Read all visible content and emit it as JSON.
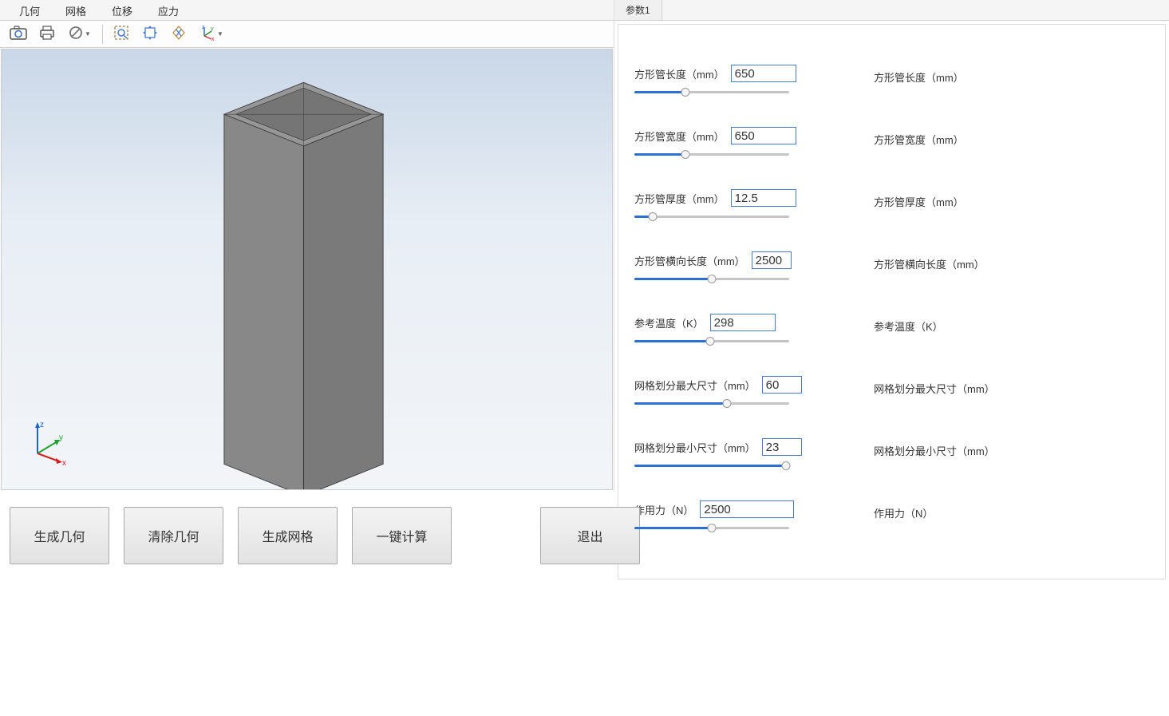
{
  "menubar": {
    "items": [
      "几何",
      "网格",
      "位移",
      "应力"
    ]
  },
  "toolbar": {
    "icons": [
      "camera-icon",
      "print-icon",
      "no-symbol-icon",
      "select-box-icon",
      "move-icon",
      "refresh-triangles-icon",
      "axis-xyz-icon"
    ]
  },
  "right_tab": {
    "label": "参数1"
  },
  "params": [
    {
      "label": "方形管长度（mm）",
      "value": "650",
      "right_label": "方形管长度（mm）",
      "slider_pct": 33
    },
    {
      "label": "方形管宽度（mm）",
      "value": "650",
      "right_label": "方形管宽度（mm）",
      "slider_pct": 33
    },
    {
      "label": "方形管厚度（mm）",
      "value": "12.5",
      "right_label": "方形管厚度（mm）",
      "slider_pct": 12
    },
    {
      "label": "方形管横向长度（mm）",
      "value": "2500",
      "right_label": "方形管横向长度（mm）",
      "slider_pct": 50,
      "input_class": "narrow"
    },
    {
      "label": "参考温度（K）",
      "value": "298",
      "right_label": "参考温度（K）",
      "slider_pct": 49,
      "input_class": ""
    },
    {
      "label": "网格划分最大尺寸（mm）",
      "value": "60",
      "right_label": "网格划分最大尺寸（mm）",
      "slider_pct": 60,
      "input_class": "narrow"
    },
    {
      "label": "网格划分最小尺寸（mm）",
      "value": "23",
      "right_label": "网格划分最小尺寸（mm）",
      "slider_pct": 98,
      "input_class": "narrow"
    },
    {
      "label": "作用力（N）",
      "value": "2500",
      "right_label": "作用力（N）",
      "slider_pct": 50
    }
  ],
  "buttons": {
    "generate_geom": "生成几何",
    "clear_geom": "清除几何",
    "generate_mesh": "生成网格",
    "one_click_calc": "一键计算",
    "exit": "退出"
  },
  "axis_labels": {
    "x": "x",
    "y": "y",
    "z": "z"
  }
}
